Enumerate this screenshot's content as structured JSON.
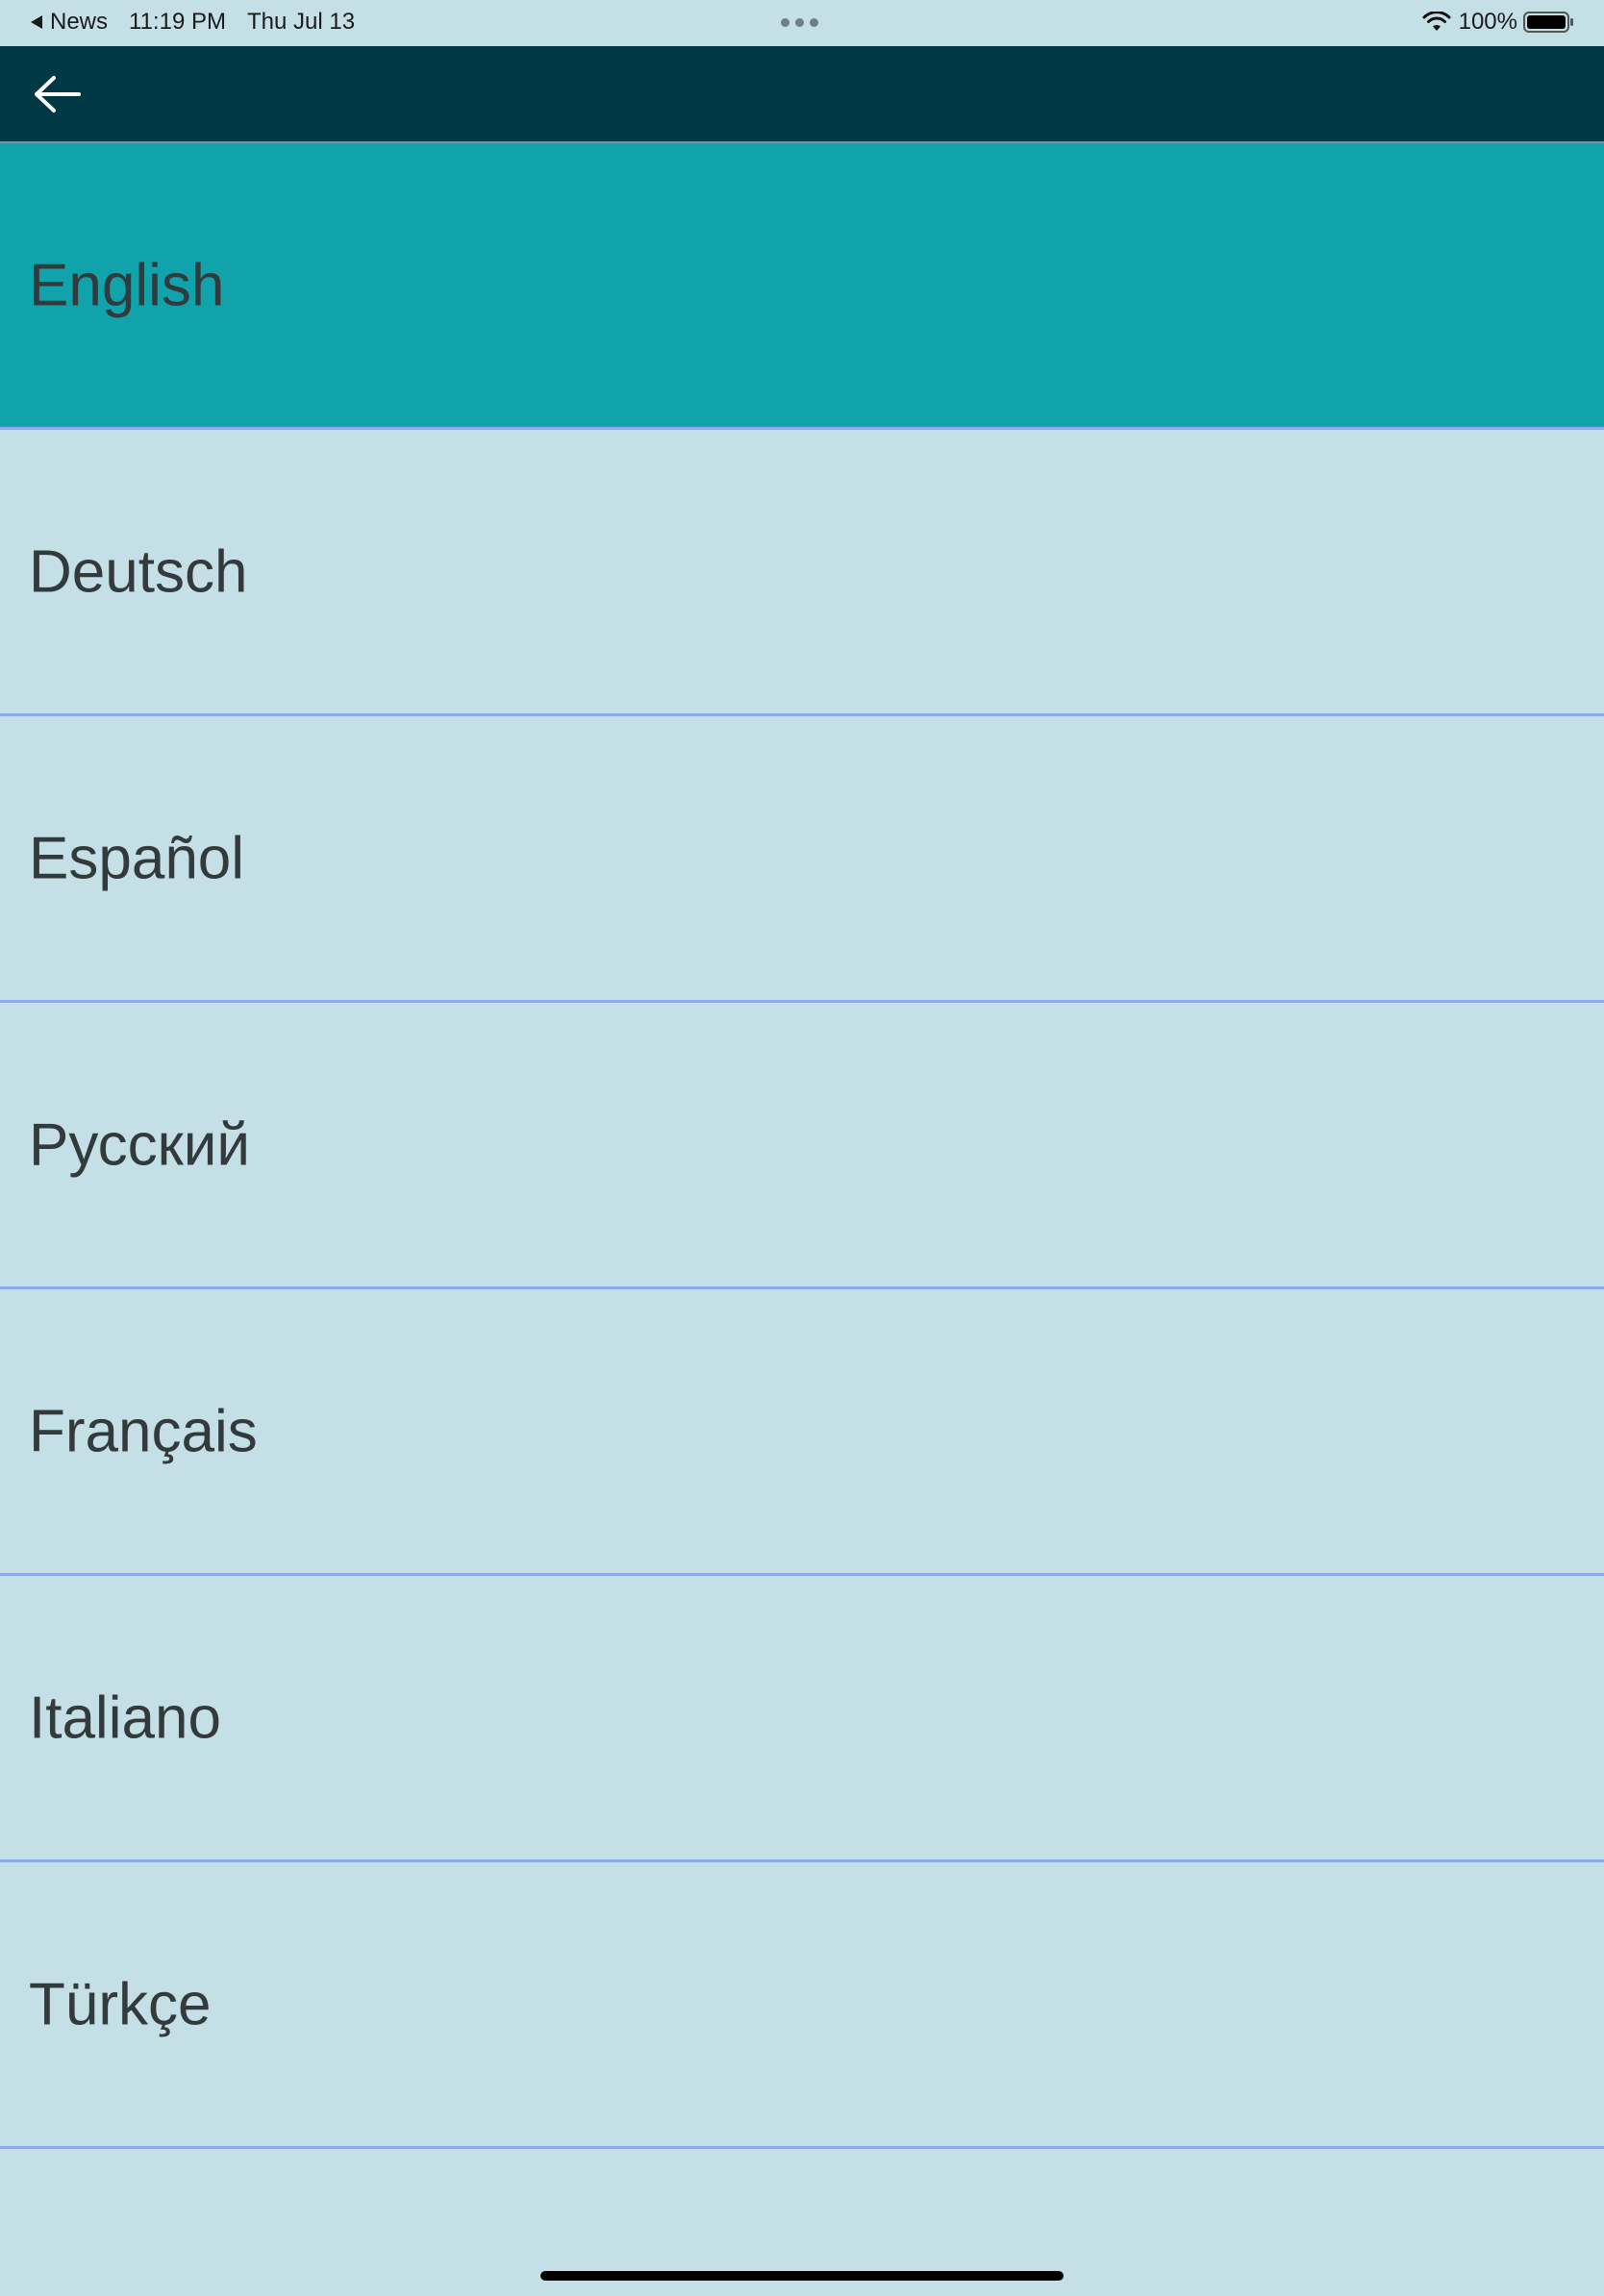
{
  "status_bar": {
    "back_app_label": "News",
    "time": "11:19 PM",
    "date": "Thu Jul 13",
    "battery_percent": "100%",
    "wifi_icon": "wifi-icon",
    "battery_icon": "battery-icon"
  },
  "toolbar": {
    "background_color": "#003845",
    "back_icon": "arrow-left-icon"
  },
  "languages": {
    "selected_color": "#10a3ac",
    "items": [
      {
        "label": "English",
        "selected": true
      },
      {
        "label": "Deutsch",
        "selected": false
      },
      {
        "label": "Español",
        "selected": false
      },
      {
        "label": "Русский",
        "selected": false
      },
      {
        "label": "Français",
        "selected": false
      },
      {
        "label": "Italiano",
        "selected": false
      },
      {
        "label": "Türkçe",
        "selected": false
      }
    ]
  }
}
